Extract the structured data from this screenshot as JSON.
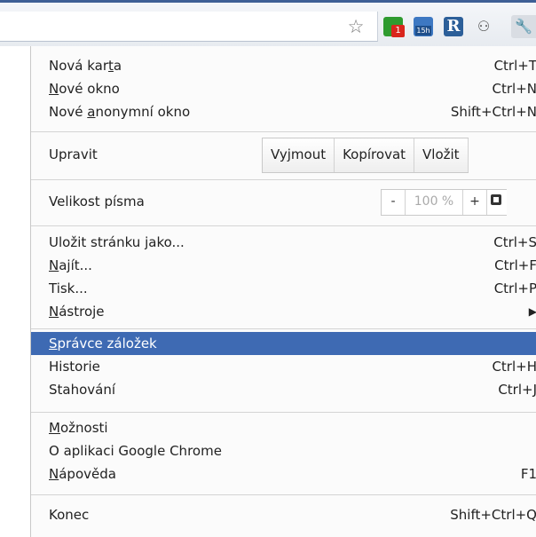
{
  "toolbar": {
    "star_icon": "star-icon",
    "extensions": [
      {
        "name": "green-arrow-extension-icon",
        "badge": "1"
      },
      {
        "name": "calendar-extension-icon",
        "badge": "15h"
      },
      {
        "name": "r-extension-icon",
        "text": "R"
      },
      {
        "name": "binoculars-extension-icon"
      },
      {
        "name": "wrench-menu-icon"
      }
    ]
  },
  "menu": {
    "new_tab": {
      "pre": "Nová kar",
      "acc": "t",
      "post": "a",
      "shortcut": "Ctrl+T"
    },
    "new_window": {
      "pre": "",
      "acc": "N",
      "post": "ové okno",
      "shortcut": "Ctrl+N"
    },
    "new_incognito": {
      "pre": "Nové ",
      "acc": "a",
      "post": "nonymní okno",
      "shortcut": "Shift+Ctrl+N"
    },
    "edit": {
      "label": "Upravit",
      "cut": "Vyjmout",
      "copy": "Kopírovat",
      "paste": "Vložit"
    },
    "zoom": {
      "label": "Velikost písma",
      "minus": "-",
      "value": "100 %",
      "plus": "+"
    },
    "save_page": {
      "pre": "Uložit stránku ",
      "acc": "j",
      "post": "ako...",
      "shortcut": "Ctrl+S"
    },
    "find": {
      "pre": "",
      "acc": "N",
      "post": "ajít...",
      "shortcut": "Ctrl+F"
    },
    "print": {
      "label": "Tisk...",
      "shortcut": "Ctrl+P"
    },
    "tools": {
      "pre": "",
      "acc": "N",
      "post": "ástroje",
      "arrow": "▶"
    },
    "bookmark_manager": {
      "pre": "",
      "acc": "S",
      "post": "právce záložek"
    },
    "history": {
      "label": "Historie",
      "shortcut": "Ctrl+H"
    },
    "downloads": {
      "label": "Stahování",
      "shortcut": "Ctrl+J"
    },
    "options": {
      "pre": "",
      "acc": "M",
      "post": "ožnosti"
    },
    "about": {
      "label": "O aplikaci Google Chrome"
    },
    "help": {
      "pre": "",
      "acc": "N",
      "post": "ápověda",
      "shortcut": "F1"
    },
    "exit": {
      "label": "Konec",
      "shortcut": "Shift+Ctrl+Q"
    }
  },
  "colors": {
    "highlight": "#3e6ab3",
    "toolbar_border": "#3e5f95"
  }
}
